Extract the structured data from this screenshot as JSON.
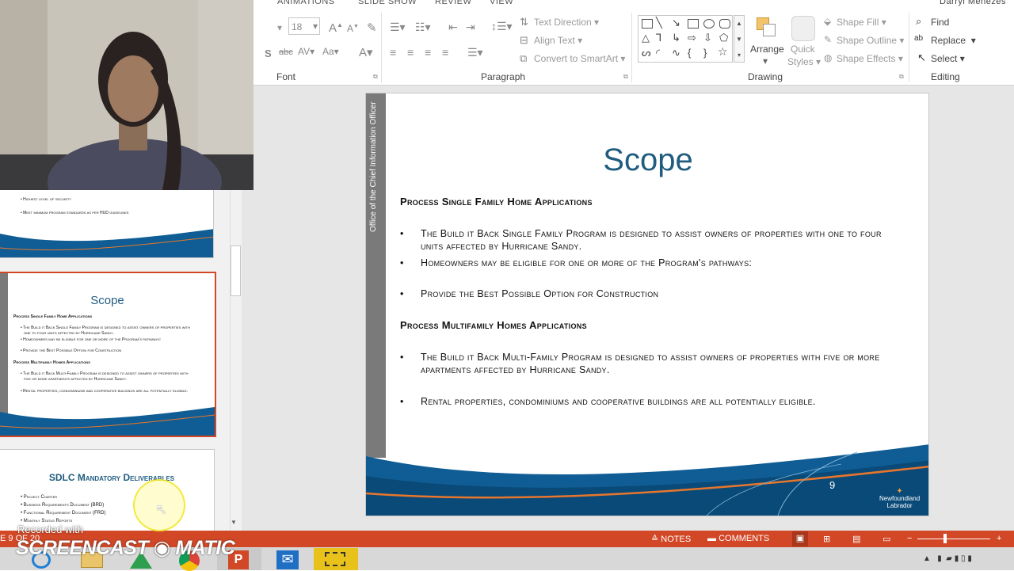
{
  "ribbon": {
    "tabs": [
      "ANIMATIONS",
      "SLIDE SHOW",
      "REVIEW",
      "VIEW"
    ],
    "user": "Darryl Menezes",
    "font_size": "18",
    "groups": {
      "font": "Font",
      "paragraph": "Paragraph",
      "drawing": "Drawing",
      "editing": "Editing"
    },
    "paragraph": {
      "text_direction": "Text Direction",
      "align_text": "Align Text",
      "convert_smartart": "Convert to SmartArt"
    },
    "drawing": {
      "arrange": "Arrange",
      "quick_styles_1": "Quick",
      "quick_styles_2": "Styles",
      "shape_fill": "Shape Fill",
      "shape_outline": "Shape Outline",
      "shape_effects": "Shape Effects"
    },
    "editing": {
      "find": "Find",
      "replace": "Replace",
      "select": "Select"
    }
  },
  "thumbnails": {
    "prev": {
      "lines": [
        "Highest level of security",
        "Meet minimum program standards as per HUD guidelines"
      ]
    },
    "current": {
      "title": "Scope",
      "lines": [
        "Process Single Family Home Applications",
        "The Build it Back Single Family Program is designed to assist owners of properties with",
        "one to four units affected by Hurricane Sandy.",
        "Homeowners may be eligible for one or more of the Program's pathways:",
        "Provide the Best Possible Option for Construction",
        "Process Multifamily Homes Applications",
        "The Build it Back Multi-Family Program is designed to assist owners of properties with",
        "five or more apartments affected by Hurricane Sandy.",
        "Rental properties, condominiums and cooperative buildings are all potentially eligible."
      ]
    },
    "next": {
      "title": "SDLC Mandatory Deliverables",
      "lines": [
        "Project Charter",
        "Business Requirements Document (BRD)",
        "Functional Requirement Document (FRD)",
        "Monthly Status Reports"
      ]
    }
  },
  "slide": {
    "sidebar_text": "Office of the Chief Information Officer",
    "title": "Scope",
    "section1_heading": "Process Single Family Home Applications",
    "bullets1": [
      "The Build it Back Single Family Program is designed to assist owners of properties with one to four units affected by Hurricane Sandy.",
      "Homeowners may be eligible for one or more of the Program's pathways:",
      "Provide the Best Possible Option for Construction"
    ],
    "section2_heading": "Process Multifamily Homes Applications",
    "bullets2": [
      "The Build it Back Multi-Family Program is designed to assist owners of properties with five or more apartments affected by Hurricane Sandy.",
      "Rental properties, condominiums and cooperative buildings are all potentially eligible."
    ],
    "page_number": "9",
    "brand_line1": "Newfoundland",
    "brand_line2": "Labrador"
  },
  "status": {
    "slide_counter": "E 9 OF 20",
    "notes": "NOTES",
    "comments": "COMMENTS"
  },
  "overlay": {
    "recorded_with": "Recorded with",
    "watermark": "SCREENCAST ◉ MATIC"
  },
  "colors": {
    "accent": "#d24726",
    "title_blue": "#1f5c7f",
    "wave_blue": "#0f5d94",
    "wave_orange": "#e8762c"
  }
}
